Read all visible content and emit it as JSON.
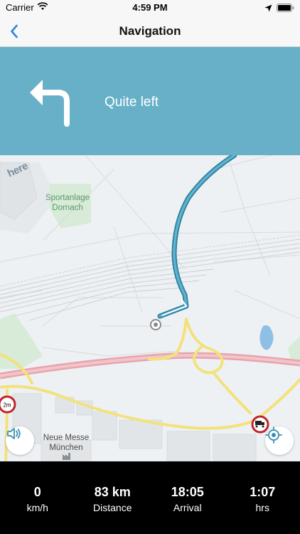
{
  "status_bar": {
    "carrier": "Carrier",
    "time": "4:59 PM",
    "icons": [
      "wifi-icon",
      "location-arrow-icon",
      "battery-icon"
    ]
  },
  "nav_bar": {
    "title": "Navigation",
    "back_icon": "chevron-left-icon"
  },
  "maneuver": {
    "instruction": "Quite left",
    "icon": "turn-left-arrow-icon",
    "panel_color": "#67b0c8"
  },
  "map": {
    "watermark": "here",
    "labels": {
      "sportanlage": "Sportanlage Dornach",
      "messe": "Neue Messe München"
    },
    "signs": {
      "height_limit": "2m",
      "truck_ban": "truck-prohibited-sign"
    },
    "route_color": "#4a9ab8",
    "buttons": [
      "speaker-icon",
      "locate-icon"
    ]
  },
  "trip_info": {
    "items": [
      {
        "value": "0",
        "label": "km/h"
      },
      {
        "value": "83 km",
        "label": "Distance"
      },
      {
        "value": "18:05",
        "label": "Arrival"
      },
      {
        "value": "1:07",
        "label": "hrs"
      }
    ]
  },
  "colors": {
    "accent": "#2a86d6",
    "info_bar_background": "#000000"
  }
}
